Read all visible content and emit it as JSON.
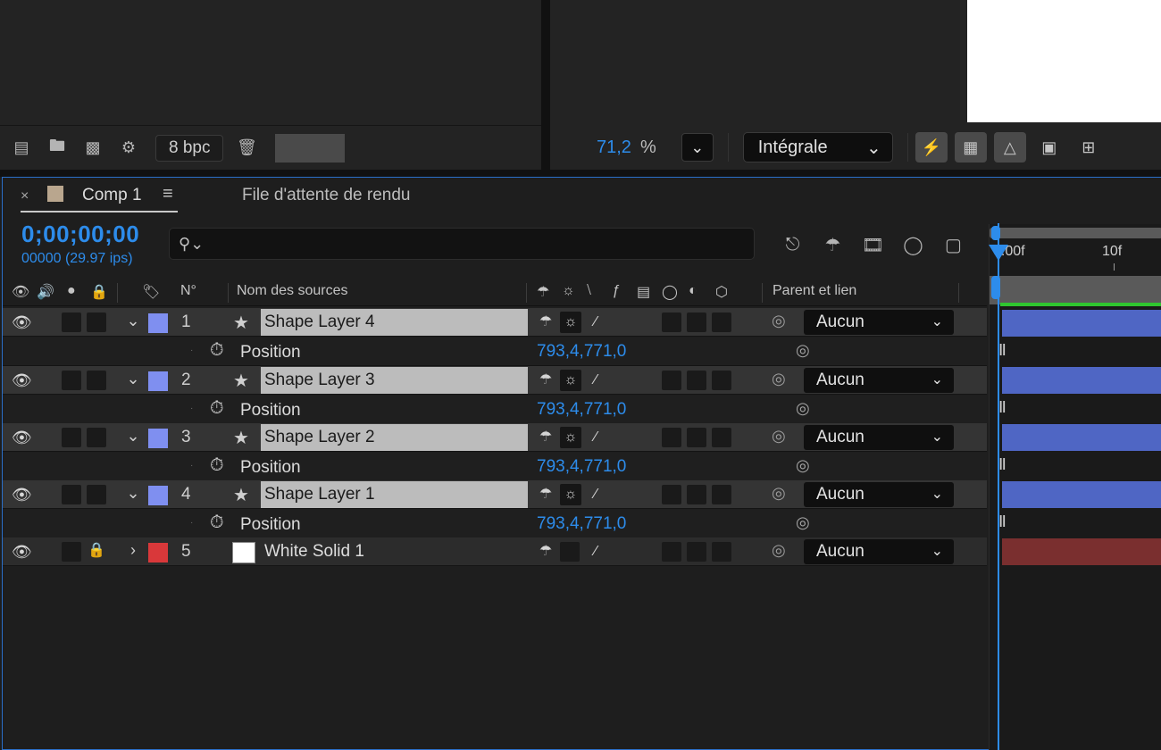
{
  "project_panel": {
    "bit_depth": "8 bpc",
    "icons": [
      "interpret-footage-icon",
      "new-folder-icon",
      "new-composition-icon",
      "project-settings-icon",
      "trash-icon"
    ]
  },
  "composition_viewer": {
    "zoom_value": "71,2",
    "zoom_unit": "%",
    "resolution": "Intégrale"
  },
  "timeline": {
    "tabs": [
      {
        "label": "Comp 1",
        "active": true,
        "color": "#b9a68e"
      },
      {
        "label": "File d'attente de rendu",
        "active": false
      }
    ],
    "timecode": "0;00;00;00",
    "frame_info": "00000 (29.97 ips)",
    "search_placeholder": "",
    "columns": {
      "number": "N°",
      "source_name": "Nom des sources",
      "parent": "Parent et lien"
    },
    "ruler": {
      "start": "0:00f",
      "mark": "10f"
    },
    "layers": [
      {
        "index": "1",
        "name": "Shape Layer 4",
        "color": "#7f8ff0",
        "type": "shape",
        "parent": "Aucun",
        "property": "Position",
        "value": "793,4,771,0"
      },
      {
        "index": "2",
        "name": "Shape Layer 3",
        "color": "#7f8ff0",
        "type": "shape",
        "parent": "Aucun",
        "property": "Position",
        "value": "793,4,771,0"
      },
      {
        "index": "3",
        "name": "Shape Layer 2",
        "color": "#7f8ff0",
        "type": "shape",
        "parent": "Aucun",
        "property": "Position",
        "value": "793,4,771,0"
      },
      {
        "index": "4",
        "name": "Shape Layer 1",
        "color": "#7f8ff0",
        "type": "shape",
        "parent": "Aucun",
        "property": "Position",
        "value": "793,4,771,0"
      },
      {
        "index": "5",
        "name": "White Solid 1",
        "color": "#d9383a",
        "type": "solid",
        "parent": "Aucun"
      }
    ]
  }
}
